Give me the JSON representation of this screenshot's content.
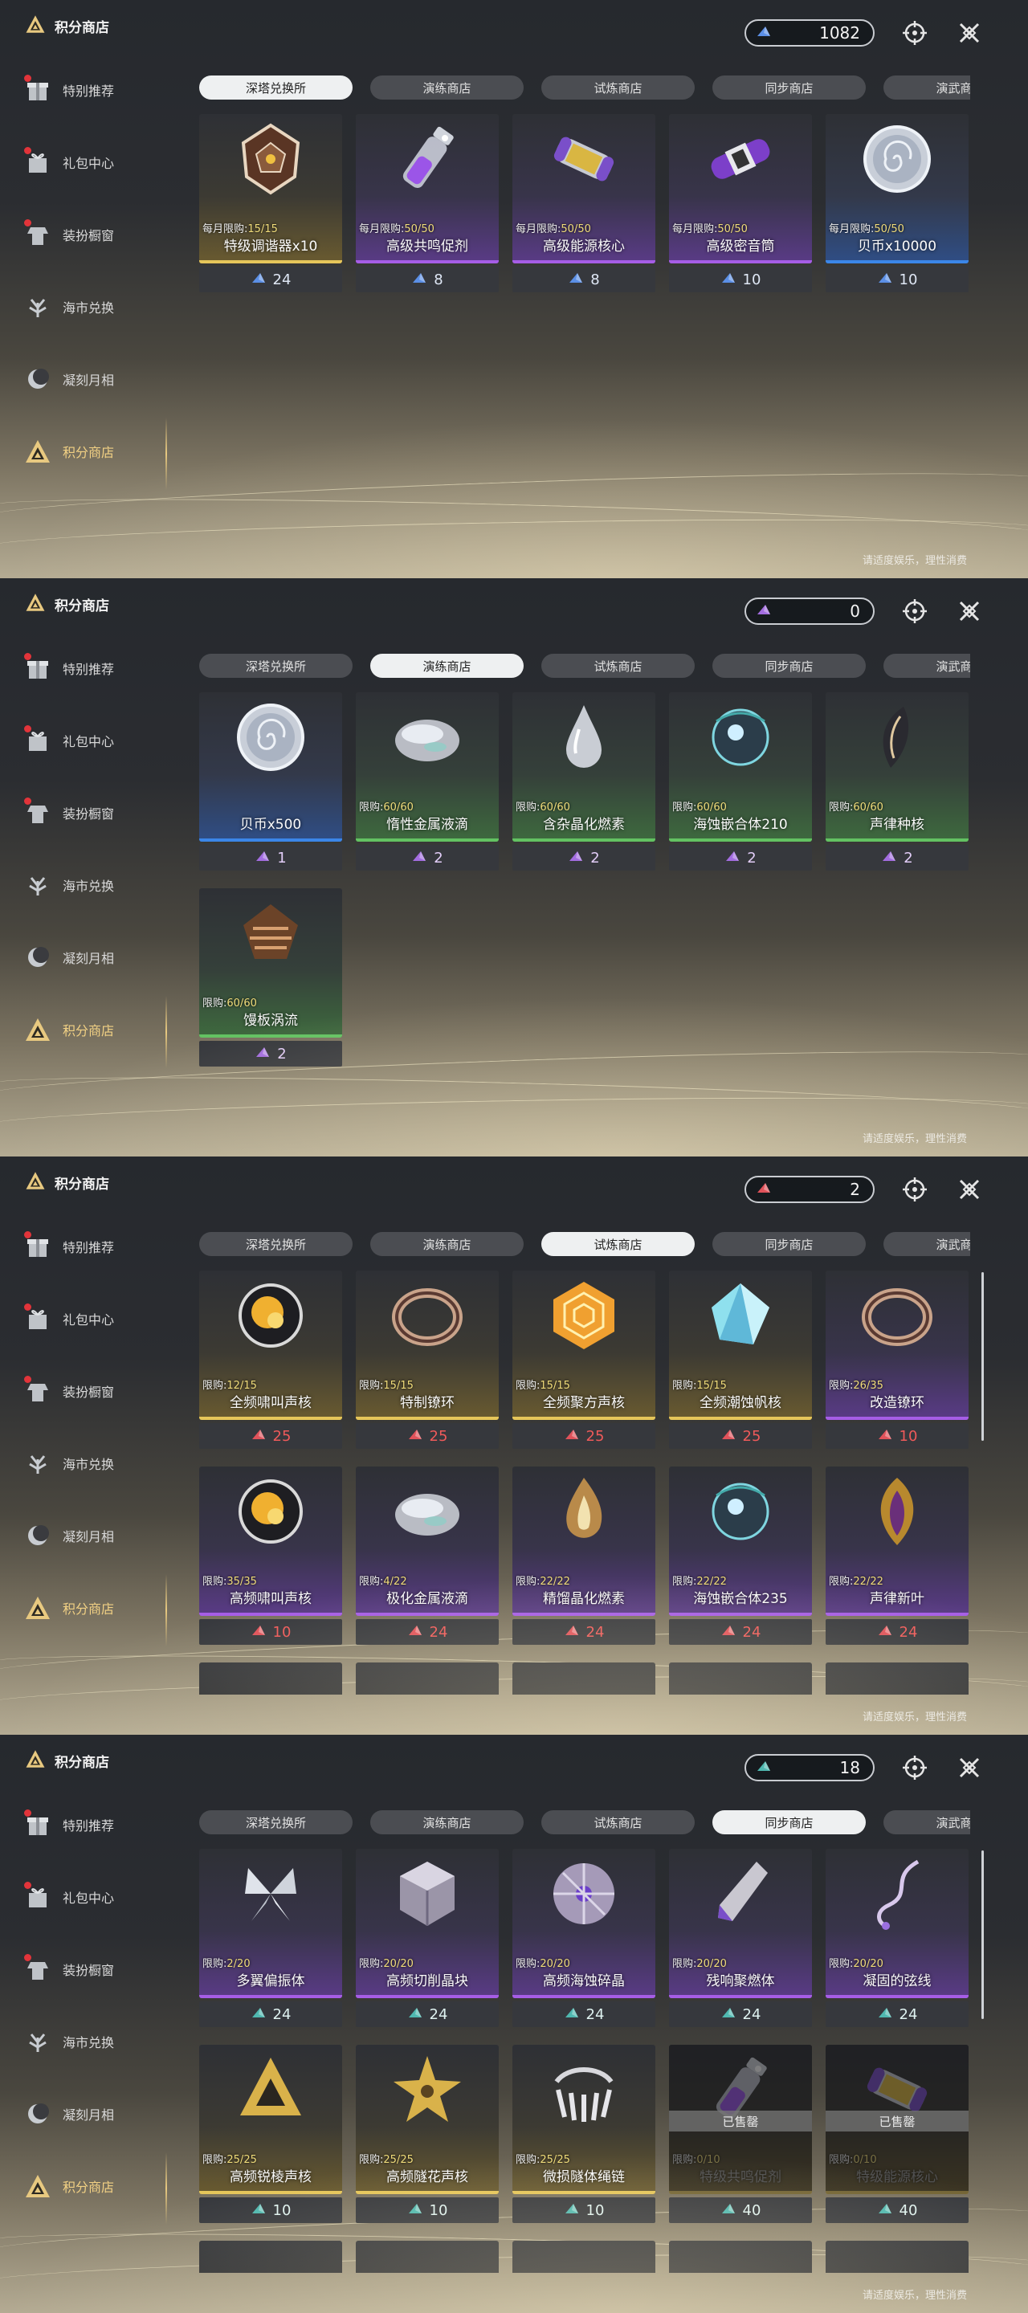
{
  "shop_title": "积分商店",
  "sidebar": [
    "特别推荐",
    "礼包中心",
    "装扮橱窗",
    "海市兑换",
    "凝刻月相",
    "积分商店"
  ],
  "tabs": [
    "深塔兑换所",
    "演练商店",
    "试炼商店",
    "同步商店",
    "演武商店"
  ],
  "footnote": "请适度娱乐，理性消费",
  "sold_out_label": "已售罄",
  "panels": [
    {
      "balance": "1082",
      "currency_color": "#5b8fe6",
      "active_tab": 0,
      "items": [
        {
          "name": "特级调谐器x10",
          "limit_label": "每月限购:",
          "limit": "15/15",
          "price": "24",
          "icon": "crystal-polyhedron-icon",
          "rarity": "gold"
        },
        {
          "name": "高级共鸣促剂",
          "limit_label": "每月限购:",
          "limit": "50/50",
          "price": "8",
          "icon": "vial-icon",
          "rarity": "purple"
        },
        {
          "name": "高级能源核心",
          "limit_label": "每月限购:",
          "limit": "50/50",
          "price": "8",
          "icon": "energy-core-icon",
          "rarity": "purple"
        },
        {
          "name": "高级密音筒",
          "limit_label": "每月限购:",
          "limit": "50/50",
          "price": "10",
          "icon": "sealed-tube-icon",
          "rarity": "purple"
        },
        {
          "name": "贝币x10000",
          "limit_label": "每月限购:",
          "limit": "50/50",
          "price": "10",
          "icon": "shell-coin-icon",
          "rarity": "blue"
        }
      ]
    },
    {
      "balance": "0",
      "currency_color": "#a36de0",
      "active_tab": 1,
      "items": [
        {
          "name": "贝币x500",
          "limit_label": "",
          "limit": "",
          "price": "1",
          "icon": "shell-coin-icon",
          "rarity": "blue"
        },
        {
          "name": "惰性金属液滴",
          "limit_label": "限购:",
          "limit": "60/60",
          "price": "2",
          "icon": "metal-droplet-icon",
          "rarity": "green"
        },
        {
          "name": "含杂晶化燃素",
          "limit_label": "限购:",
          "limit": "60/60",
          "price": "2",
          "icon": "crystal-drop-icon",
          "rarity": "green"
        },
        {
          "name": "海蚀嵌合体210",
          "limit_label": "限购:",
          "limit": "60/60",
          "price": "2",
          "icon": "eroded-chimera-icon",
          "rarity": "green"
        },
        {
          "name": "声律种核",
          "limit_label": "限购:",
          "limit": "60/60",
          "price": "2",
          "icon": "seed-core-icon",
          "rarity": "green"
        },
        {
          "name": "馒板涡流",
          "limit_label": "限购:",
          "limit": "60/60",
          "price": "2",
          "icon": "vortex-icon",
          "rarity": "green"
        }
      ]
    },
    {
      "balance": "2",
      "currency_color": "#e0525a",
      "active_tab": 2,
      "items": [
        {
          "name": "全频啸叫声核",
          "limit_label": "限购:",
          "limit": "12/15",
          "price": "25",
          "icon": "howl-core-icon",
          "rarity": "gold"
        },
        {
          "name": "特制镣环",
          "limit_label": "限购:",
          "limit": "15/15",
          "price": "25",
          "icon": "ring-icon",
          "rarity": "gold"
        },
        {
          "name": "全频聚方声核",
          "limit_label": "限购:",
          "limit": "15/15",
          "price": "25",
          "icon": "gold-hex-core-icon",
          "rarity": "gold"
        },
        {
          "name": "全频潮蚀帆核",
          "limit_label": "限购:",
          "limit": "15/15",
          "price": "25",
          "icon": "tide-sail-core-icon",
          "rarity": "gold"
        },
        {
          "name": "改造镣环",
          "limit_label": "限购:",
          "limit": "26/35",
          "price": "10",
          "icon": "ring-icon",
          "rarity": "purple"
        },
        {
          "name": "高频啸叫声核",
          "limit_label": "限购:",
          "limit": "35/35",
          "price": "10",
          "icon": "howl-core-icon",
          "rarity": "purple"
        },
        {
          "name": "极化金属液滴",
          "limit_label": "限购:",
          "limit": "4/22",
          "price": "24",
          "icon": "metal-droplet-icon",
          "rarity": "purple"
        },
        {
          "name": "精馏晶化燃素",
          "limit_label": "限购:",
          "limit": "22/22",
          "price": "24",
          "icon": "flame-crystal-icon",
          "rarity": "purple"
        },
        {
          "name": "海蚀嵌合体235",
          "limit_label": "限购:",
          "limit": "22/22",
          "price": "24",
          "icon": "eroded-chimera-icon",
          "rarity": "purple"
        },
        {
          "name": "声律新叶",
          "limit_label": "限购:",
          "limit": "22/22",
          "price": "24",
          "icon": "new-leaf-icon",
          "rarity": "purple"
        }
      ]
    },
    {
      "balance": "18",
      "currency_color": "#4fb8b0",
      "active_tab": 3,
      "items": [
        {
          "name": "多翼偏振体",
          "limit_label": "限购:",
          "limit": "2/20",
          "price": "24",
          "icon": "multi-wing-icon",
          "rarity": "purple"
        },
        {
          "name": "高频切削晶块",
          "limit_label": "限购:",
          "limit": "20/20",
          "price": "24",
          "icon": "cut-crystal-block-icon",
          "rarity": "purple"
        },
        {
          "name": "高频海蚀碎晶",
          "limit_label": "限购:",
          "limit": "20/20",
          "price": "24",
          "icon": "broken-crystal-icon",
          "rarity": "purple"
        },
        {
          "name": "残响聚燃体",
          "limit_label": "限购:",
          "limit": "20/20",
          "price": "24",
          "icon": "shard-icon",
          "rarity": "purple"
        },
        {
          "name": "凝固的弦线",
          "limit_label": "限购:",
          "limit": "20/20",
          "price": "24",
          "icon": "string-icon",
          "rarity": "purple"
        },
        {
          "name": "高频锐棱声核",
          "limit_label": "限购:",
          "limit": "25/25",
          "price": "10",
          "icon": "sharp-prism-core-icon",
          "rarity": "gold"
        },
        {
          "name": "高频隧花声核",
          "limit_label": "限购:",
          "limit": "25/25",
          "price": "10",
          "icon": "tunnel-flower-core-icon",
          "rarity": "gold"
        },
        {
          "name": "微损隧体绳链",
          "limit_label": "限购:",
          "limit": "25/25",
          "price": "10",
          "icon": "chain-icon",
          "rarity": "gold"
        },
        {
          "name": "特级共鸣促剂",
          "limit_label": "限购:",
          "limit": "0/10",
          "price": "40",
          "icon": "vial-icon",
          "rarity": "gold",
          "sold_out": true
        },
        {
          "name": "特级能源核心",
          "limit_label": "限购:",
          "limit": "0/10",
          "price": "40",
          "icon": "energy-core-icon",
          "rarity": "gold",
          "sold_out": true
        }
      ]
    }
  ]
}
